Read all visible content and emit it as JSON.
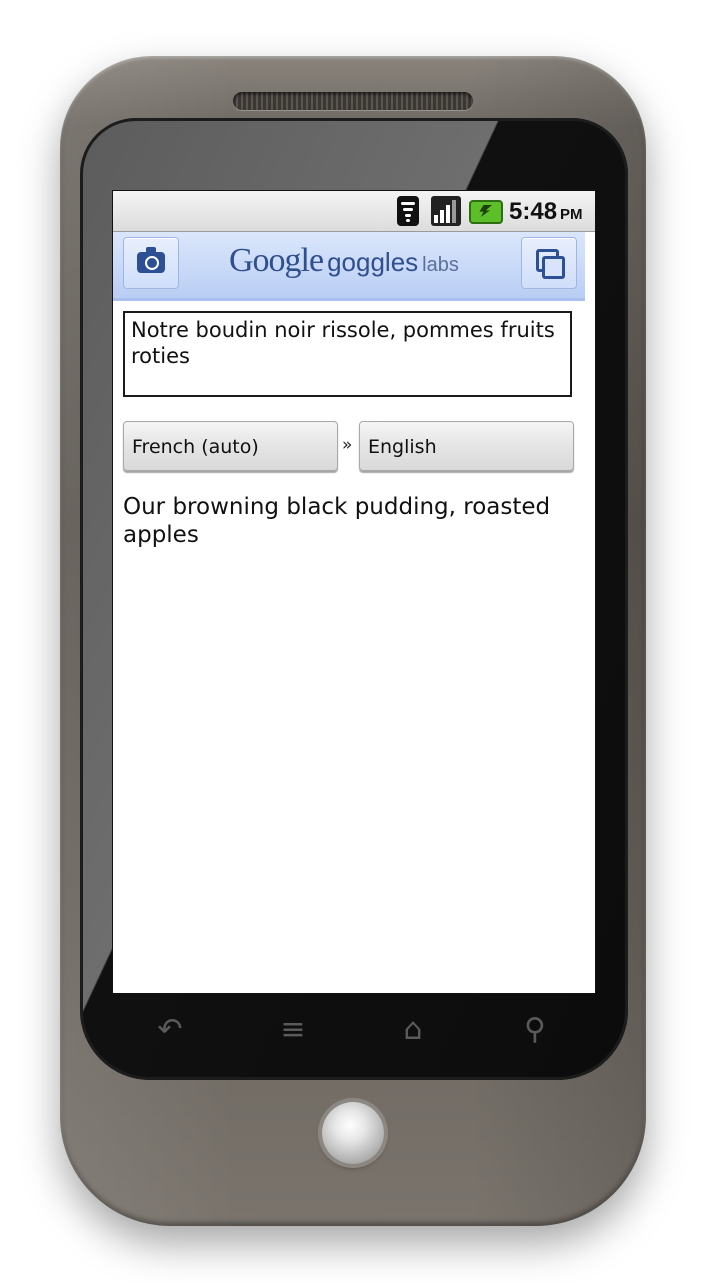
{
  "status_bar": {
    "time": "5:48",
    "ampm": "PM",
    "icons": [
      "wifi-icon",
      "signal-icon",
      "battery-charging-icon"
    ]
  },
  "app_header": {
    "logo_google": "Google",
    "logo_goggles": "goggles",
    "logo_labs": "labs",
    "left_button_icon": "camera-icon",
    "right_button_icon": "copy-icon",
    "background_color": "#c7d8f7"
  },
  "translation": {
    "source_text": "Notre boudin noir rissole, pommes fruits roties",
    "source_language": "French (auto)",
    "separator": "»",
    "target_language": "English",
    "result_text": "Our browning black pudding, roasted apples"
  },
  "hardware_keys": {
    "back_glyph": "↶",
    "menu_glyph": "≡",
    "home_glyph": "⌂",
    "search_glyph": "⚲"
  }
}
